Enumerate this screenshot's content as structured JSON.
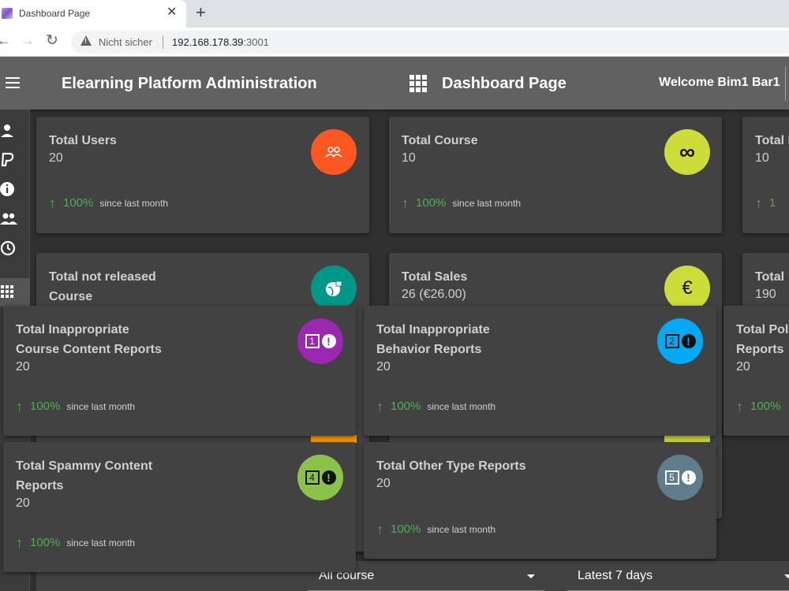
{
  "browser": {
    "tab_title": "Dashboard Page",
    "tab_close": "✕",
    "new_tab": "+",
    "not_secure": "Nicht sicher",
    "url_host": "192.168.178.39",
    "url_port": ":3001"
  },
  "header": {
    "app_title": "Elearning Platform Administration",
    "page_title": "Dashboard Page",
    "welcome": "Welcome Bim1 Bar1"
  },
  "sidebar": {
    "items": [
      {
        "icon": "person-icon"
      },
      {
        "icon": "paypal-icon"
      },
      {
        "icon": "info-icon"
      },
      {
        "icon": "group-icon"
      },
      {
        "icon": "history-icon"
      },
      {
        "icon": "apps-icon"
      }
    ]
  },
  "cards_back": [
    {
      "title": "Total Users",
      "value": "20",
      "trend": "100%",
      "since": "since last month",
      "icon": "group-icon",
      "color": "#ff5722"
    },
    {
      "title": "Total Course",
      "value": "10",
      "trend": "100%",
      "since": "since last month",
      "icon": "infinity-icon",
      "color": "#cddc39"
    },
    {
      "title": "Total I",
      "value": "10",
      "trend": "1",
      "icon": "none"
    },
    {
      "title": "Total not released Course",
      "title_line1": "Total not released",
      "title_line2": "Course",
      "icon": "public-lock-icon",
      "color": "#009688"
    },
    {
      "title": "Total Sales",
      "value": "26 (€26.00)",
      "icon": "euro-icon",
      "color": "#cddc39"
    },
    {
      "title": "Total",
      "value": "190"
    }
  ],
  "cards_front": [
    {
      "title_line1": "Total Inappropriate",
      "title_line2": "Course Content Reports",
      "value": "20",
      "trend": "100%",
      "since": "since last month",
      "num": "1",
      "color": "#9c27b0"
    },
    {
      "title_line1": "Total Inappropriate",
      "title_line2": "Behavior Reports",
      "value": "20",
      "trend": "100%",
      "since": "since last month",
      "num": "2",
      "color": "#03a9f4"
    },
    {
      "title_line1": "Total Pol",
      "title_line2": "Reports",
      "value": "20",
      "trend": "100%"
    },
    {
      "title_line1": "Total Spammy Content",
      "title_line2": "Reports",
      "value": "20",
      "trend": "100%",
      "since": "since last month",
      "num": "4",
      "color": "#8bc34a"
    },
    {
      "title_line1": "Total Other Type Reports",
      "value": "20",
      "trend": "100%",
      "since": "since last month",
      "num": "5",
      "color": "#607d8b"
    }
  ],
  "filters": {
    "course_select": "All course",
    "range_select": "Latest 7 days"
  }
}
